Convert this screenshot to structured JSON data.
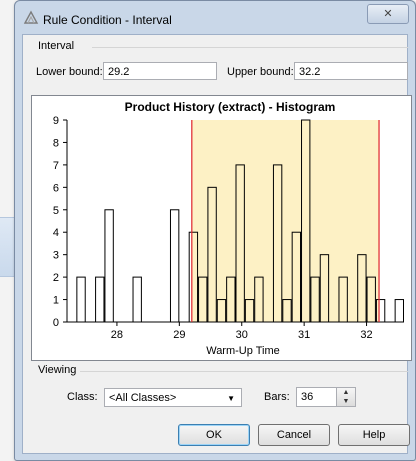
{
  "window": {
    "title": "Rule Condition - Interval",
    "close_glyph": "✕"
  },
  "interval": {
    "group_label": "Interval",
    "lower_label": "Lower bound:",
    "lower_value": "29.2",
    "upper_label": "Upper bound:",
    "upper_value": "32.2"
  },
  "chart_data": {
    "type": "bar",
    "title": "Product History (extract) - Histogram",
    "xlabel": "Warm-Up Time",
    "ylabel": "",
    "ylim": [
      0,
      9
    ],
    "yticks": [
      0,
      1,
      2,
      3,
      4,
      5,
      6,
      7,
      8,
      9
    ],
    "xlim": [
      27.2,
      32.6
    ],
    "xticks": [
      28,
      29,
      30,
      31,
      32
    ],
    "bin_width": 0.15,
    "bins": [
      {
        "x0": 27.35,
        "value": 2
      },
      {
        "x0": 27.65,
        "value": 2
      },
      {
        "x0": 27.8,
        "value": 5
      },
      {
        "x0": 28.25,
        "value": 2
      },
      {
        "x0": 28.85,
        "value": 5
      },
      {
        "x0": 29.15,
        "value": 4
      },
      {
        "x0": 29.3,
        "value": 2
      },
      {
        "x0": 29.45,
        "value": 6
      },
      {
        "x0": 29.6,
        "value": 1
      },
      {
        "x0": 29.75,
        "value": 2
      },
      {
        "x0": 29.9,
        "value": 7
      },
      {
        "x0": 30.05,
        "value": 1
      },
      {
        "x0": 30.2,
        "value": 2
      },
      {
        "x0": 30.5,
        "value": 7
      },
      {
        "x0": 30.65,
        "value": 1
      },
      {
        "x0": 30.8,
        "value": 4
      },
      {
        "x0": 30.95,
        "value": 9
      },
      {
        "x0": 31.1,
        "value": 2
      },
      {
        "x0": 31.25,
        "value": 3
      },
      {
        "x0": 31.55,
        "value": 2
      },
      {
        "x0": 31.85,
        "value": 3
      },
      {
        "x0": 32.0,
        "value": 2
      },
      {
        "x0": 32.15,
        "value": 1
      },
      {
        "x0": 32.45,
        "value": 1
      }
    ],
    "interval": {
      "lower": 29.2,
      "upper": 32.2,
      "fill": "#fdf1c5",
      "line_color": "#e0242a"
    },
    "bar_fill": "#ffffff",
    "bar_stroke": "#000000"
  },
  "viewing": {
    "group_label": "Viewing",
    "class_label": "Class:",
    "class_value": "<All Classes>",
    "bars_label": "Bars:",
    "bars_value": "36"
  },
  "buttons": {
    "ok": "OK",
    "cancel": "Cancel",
    "help": "Help"
  }
}
